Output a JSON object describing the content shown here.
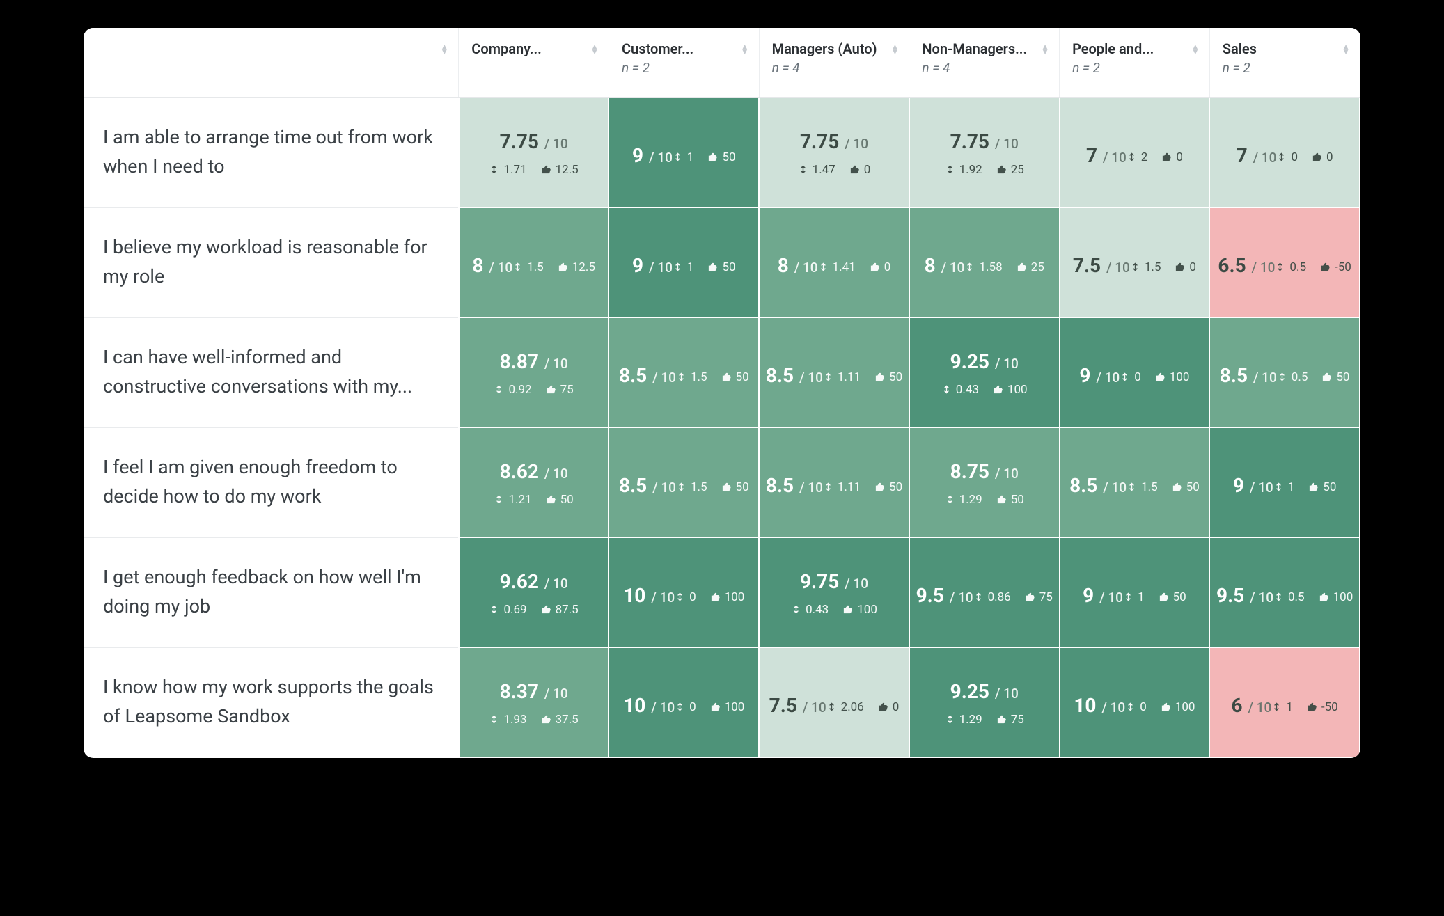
{
  "chart_data": {
    "type": "heatmap",
    "title": "",
    "score_denominator": "10",
    "out_of_prefix": "/ ",
    "columns": [
      {
        "label": "Company...",
        "n": ""
      },
      {
        "label": "Customer...",
        "n": "n = 2"
      },
      {
        "label": "Managers (Auto)",
        "n": "n = 4"
      },
      {
        "label": "Non-Managers...",
        "n": "n = 4"
      },
      {
        "label": "People and...",
        "n": "n = 2"
      },
      {
        "label": "Sales",
        "n": "n = 2"
      }
    ],
    "rows": [
      {
        "label": "I am able to arrange time out from work when I need to",
        "cells": [
          {
            "score": "7.75",
            "spread": "1.71",
            "thumbs": "12.5",
            "shade": "pale"
          },
          {
            "score": "9",
            "spread": "1",
            "thumbs": "50",
            "shade": "deep"
          },
          {
            "score": "7.75",
            "spread": "1.47",
            "thumbs": "0",
            "shade": "pale"
          },
          {
            "score": "7.75",
            "spread": "1.92",
            "thumbs": "25",
            "shade": "pale"
          },
          {
            "score": "7",
            "spread": "2",
            "thumbs": "0",
            "shade": "pale"
          },
          {
            "score": "7",
            "spread": "0",
            "thumbs": "0",
            "shade": "pale"
          }
        ]
      },
      {
        "label": "I believe my workload is reasonable for my role",
        "cells": [
          {
            "score": "8",
            "spread": "1.5",
            "thumbs": "12.5",
            "shade": "mid"
          },
          {
            "score": "9",
            "spread": "1",
            "thumbs": "50",
            "shade": "deep"
          },
          {
            "score": "8",
            "spread": "1.41",
            "thumbs": "0",
            "shade": "mid"
          },
          {
            "score": "8",
            "spread": "1.58",
            "thumbs": "25",
            "shade": "mid"
          },
          {
            "score": "7.5",
            "spread": "1.5",
            "thumbs": "0",
            "shade": "pale"
          },
          {
            "score": "6.5",
            "spread": "0.5",
            "thumbs": "-50",
            "shade": "neg"
          }
        ]
      },
      {
        "label": "I can have well-informed and constructive conversations with my...",
        "cells": [
          {
            "score": "8.87",
            "spread": "0.92",
            "thumbs": "75",
            "shade": "mid"
          },
          {
            "score": "8.5",
            "spread": "1.5",
            "thumbs": "50",
            "shade": "mid"
          },
          {
            "score": "8.5",
            "spread": "1.11",
            "thumbs": "50",
            "shade": "mid"
          },
          {
            "score": "9.25",
            "spread": "0.43",
            "thumbs": "100",
            "shade": "deep"
          },
          {
            "score": "9",
            "spread": "0",
            "thumbs": "100",
            "shade": "deep"
          },
          {
            "score": "8.5",
            "spread": "0.5",
            "thumbs": "50",
            "shade": "mid"
          }
        ]
      },
      {
        "label": "I feel I am given enough freedom to decide how to do my work",
        "cells": [
          {
            "score": "8.62",
            "spread": "1.21",
            "thumbs": "50",
            "shade": "mid"
          },
          {
            "score": "8.5",
            "spread": "1.5",
            "thumbs": "50",
            "shade": "mid"
          },
          {
            "score": "8.5",
            "spread": "1.11",
            "thumbs": "50",
            "shade": "mid"
          },
          {
            "score": "8.75",
            "spread": "1.29",
            "thumbs": "50",
            "shade": "mid"
          },
          {
            "score": "8.5",
            "spread": "1.5",
            "thumbs": "50",
            "shade": "mid"
          },
          {
            "score": "9",
            "spread": "1",
            "thumbs": "50",
            "shade": "deep"
          }
        ]
      },
      {
        "label": "I get enough feedback on how well I'm doing my job",
        "cells": [
          {
            "score": "9.62",
            "spread": "0.69",
            "thumbs": "87.5",
            "shade": "deep"
          },
          {
            "score": "10",
            "spread": "0",
            "thumbs": "100",
            "shade": "deep"
          },
          {
            "score": "9.75",
            "spread": "0.43",
            "thumbs": "100",
            "shade": "deep"
          },
          {
            "score": "9.5",
            "spread": "0.86",
            "thumbs": "75",
            "shade": "deep"
          },
          {
            "score": "9",
            "spread": "1",
            "thumbs": "50",
            "shade": "deep"
          },
          {
            "score": "9.5",
            "spread": "0.5",
            "thumbs": "100",
            "shade": "deep"
          }
        ]
      },
      {
        "label": "I know how my work supports the goals of Leapsome Sandbox",
        "cells": [
          {
            "score": "8.37",
            "spread": "1.93",
            "thumbs": "37.5",
            "shade": "mid"
          },
          {
            "score": "10",
            "spread": "0",
            "thumbs": "100",
            "shade": "deep"
          },
          {
            "score": "7.5",
            "spread": "2.06",
            "thumbs": "0",
            "shade": "pale"
          },
          {
            "score": "9.25",
            "spread": "1.29",
            "thumbs": "75",
            "shade": "deep"
          },
          {
            "score": "10",
            "spread": "0",
            "thumbs": "100",
            "shade": "deep"
          },
          {
            "score": "6",
            "spread": "1",
            "thumbs": "-50",
            "shade": "neg"
          }
        ]
      }
    ],
    "palette": {
      "pale": "#cfe1d9",
      "mid": "#6fa88e",
      "deep": "#4e9379",
      "neg": "#f3b6b7"
    }
  }
}
